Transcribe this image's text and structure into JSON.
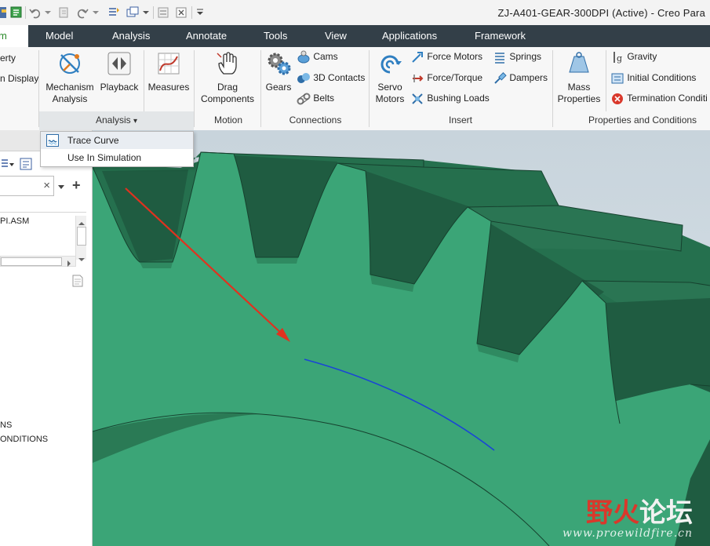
{
  "window": {
    "title": "ZJ-A401-GEAR-300DPI (Active) - Creo Para"
  },
  "tabs": {
    "active_partial": "m",
    "items": [
      "Model",
      "Analysis",
      "Annotate",
      "Tools",
      "View",
      "Applications",
      "Framework"
    ]
  },
  "ribbon": {
    "left_partial": {
      "item1": "erty",
      "item2": "n Display"
    },
    "analysis": {
      "mechanism_analysis": "Mechanism\nAnalysis",
      "playback": "Playback",
      "measures": "Measures",
      "group_label": "Analysis",
      "dropdown_arrow": "▾"
    },
    "motion": {
      "drag_components": "Drag\nComponents",
      "group_label": "Motion"
    },
    "connections": {
      "gears": "Gears",
      "cams": "Cams",
      "contacts_3d": "3D Contacts",
      "belts": "Belts",
      "group_label": "Connections"
    },
    "insert": {
      "servo_motors": "Servo\nMotors",
      "force_motors": "Force Motors",
      "force_torque": "Force/Torque",
      "bushing_loads": "Bushing Loads",
      "springs": "Springs",
      "dampers": "Dampers",
      "group_label": "Insert"
    },
    "properties": {
      "mass_properties": "Mass\nProperties",
      "gravity": "Gravity",
      "initial_conditions": "Initial Conditions",
      "termination_conditions": "Termination Conditi",
      "group_label": "Properties and Conditions"
    }
  },
  "dropdown": {
    "items": [
      "Trace Curve",
      "Use In Simulation"
    ]
  },
  "left_panel": {
    "search_value": "",
    "clear_glyph": "×",
    "add_glyph": "+",
    "tree": [
      "PI.ASM"
    ],
    "bottom_items": [
      "NS",
      "ONDITIONS"
    ]
  },
  "watermark": {
    "text_cn": "野火论坛",
    "url": "www.proewildfire.cn"
  },
  "colors": {
    "gear_face": "#3ba577",
    "gear_side": "#25704e",
    "gear_dark": "#1f5c41",
    "tab_bar": "#333f48",
    "trace_curve": "#1a45d6",
    "annotation_arrow": "#e0321f",
    "watermark_red": "#d9382b"
  }
}
